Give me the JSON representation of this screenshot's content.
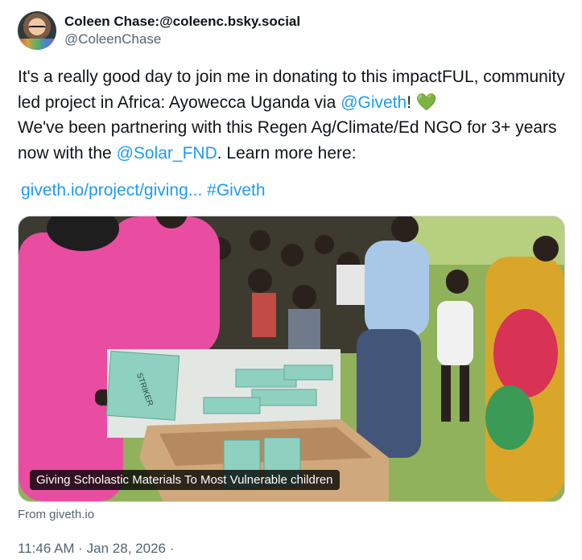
{
  "author": {
    "display_name": "Coleen Chase:@coleenc.bsky.social",
    "handle": "@ColeenChase"
  },
  "tweet": {
    "text_1": "It's a really good day to join me in donating to this impactFUL, community led project in Africa: Ayowecca Uganda via ",
    "mention_giveth": "@Giveth",
    "text_2": "! ",
    "heart": "💚",
    "text_3": " We've been partnering with this Regen Ag/Climate/Ed NGO for 3+ years now with the ",
    "mention_solar": "@Solar_FND",
    "text_4": ". Learn more here:",
    "link_url": "giveth.io/project/giving...",
    "hashtag": "#Giveth"
  },
  "card": {
    "caption": "Giving Scholastic Materials To Most Vulnerable children",
    "source": "From giveth.io"
  },
  "meta": {
    "timestamp": "11:46 AM · Jan 28, 2026 ·"
  },
  "colors": {
    "link": "#1d9bf0",
    "secondary_text": "#536471",
    "heart": "#5bb94f"
  }
}
